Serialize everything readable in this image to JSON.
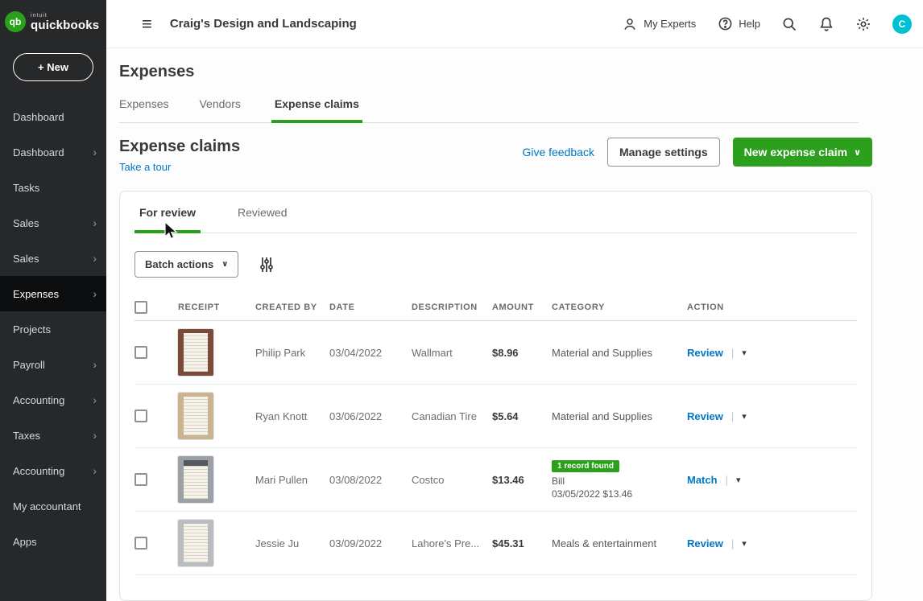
{
  "colors": {
    "green": "#2ca01c",
    "link_blue": "#0077c5",
    "sidebar_bg": "#26282a",
    "avatar_bg": "#00c1d4"
  },
  "brand": {
    "logo_sub": "intuit",
    "logo_main": "quickbooks",
    "logo_badge": "qb"
  },
  "topbar": {
    "company_name": "Craig's Design and Landscaping",
    "my_experts": "My Experts",
    "help": "Help",
    "avatar_letter": "C",
    "hamburger_glyph": "≡"
  },
  "sidebar": {
    "new_button": "+ New",
    "chevron_glyph": "›",
    "items": [
      {
        "label": "Dashboard"
      },
      {
        "label": "Dashboard"
      },
      {
        "label": "Tasks"
      },
      {
        "label": "Sales"
      },
      {
        "label": "Sales"
      },
      {
        "label": "Expenses"
      },
      {
        "label": "Projects"
      },
      {
        "label": "Payroll"
      },
      {
        "label": "Accounting"
      },
      {
        "label": "Taxes"
      },
      {
        "label": "Accounting"
      },
      {
        "label": "My accountant"
      },
      {
        "label": "Apps"
      }
    ]
  },
  "page": {
    "title": "Expenses",
    "tabs": [
      {
        "label": "Expenses"
      },
      {
        "label": "Vendors"
      },
      {
        "label": "Expense claims"
      }
    ],
    "section_title": "Expense claims",
    "take_a_tour": "Take a tour",
    "give_feedback": "Give feedback",
    "manage_settings": "Manage settings",
    "new_expense_claim": "New expense claim",
    "caret_glyph": "∨"
  },
  "claims": {
    "tabs": [
      {
        "label": "For review"
      },
      {
        "label": "Reviewed"
      }
    ],
    "batch_actions": "Batch actions",
    "columns": [
      "RECEIPT",
      "CREATED BY",
      "DATE",
      "DESCRIPTION",
      "AMOUNT",
      "CATEGORY",
      "ACTION"
    ],
    "row_caret_glyph": "▾",
    "pipe_glyph": "|",
    "rows": [
      {
        "created_by": "Philip Park",
        "date": "03/04/2022",
        "description": "Wallmart",
        "amount": "$8.96",
        "category": "Material and Supplies",
        "action": "Review"
      },
      {
        "created_by": "Ryan Knott",
        "date": "03/06/2022",
        "description": "Canadian Tire",
        "amount": "$5.64",
        "category": "Material and Supplies",
        "action": "Review"
      },
      {
        "created_by": "Mari Pullen",
        "date": "03/08/2022",
        "description": "Costco",
        "amount": "$13.46",
        "badge": "1 record found",
        "category_line1": "Bill",
        "category_line2": "03/05/2022 $13.46",
        "action": "Match"
      },
      {
        "created_by": "Jessie Ju",
        "date": "03/09/2022",
        "description": "Lahore's Pre...",
        "amount": "$45.31",
        "category": "Meals & entertainment",
        "action": "Review"
      }
    ]
  }
}
